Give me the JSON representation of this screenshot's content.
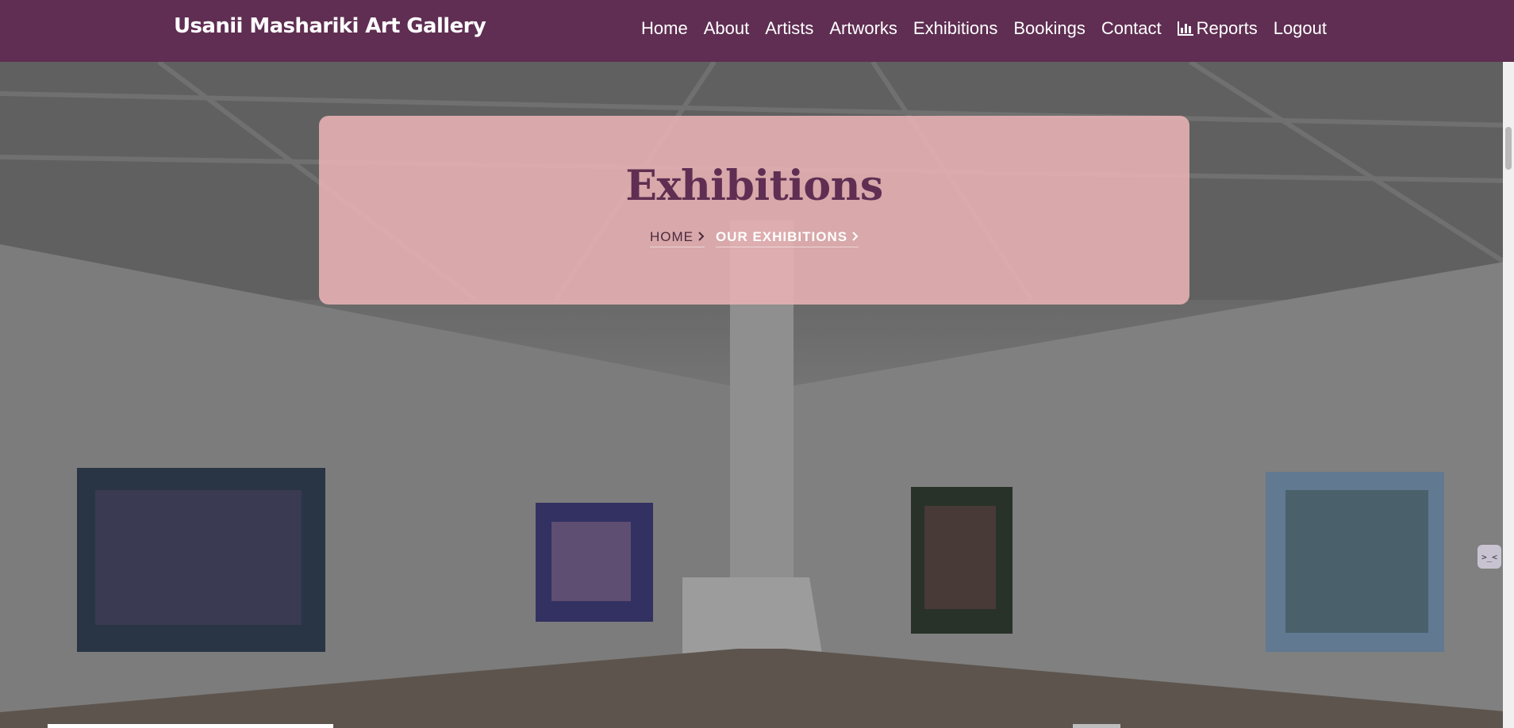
{
  "brand": {
    "name": "Usanii Mashariki Art Gallery"
  },
  "nav": {
    "items": [
      {
        "label": "Home"
      },
      {
        "label": "About"
      },
      {
        "label": "Artists"
      },
      {
        "label": "Artworks"
      },
      {
        "label": "Exhibitions"
      },
      {
        "label": "Bookings"
      },
      {
        "label": "Contact"
      },
      {
        "label": "Reports",
        "icon": "bar-chart-icon"
      },
      {
        "label": "Logout"
      }
    ]
  },
  "hero": {
    "title": "Exhibitions",
    "breadcrumb": {
      "home": "HOME",
      "current": "OUR EXHIBITIONS"
    }
  },
  "widget": {
    "label": ">_<"
  },
  "colors": {
    "navbar": "#5f2e52",
    "title_card": "#e8b2b4",
    "title_text": "#5f2e52"
  }
}
